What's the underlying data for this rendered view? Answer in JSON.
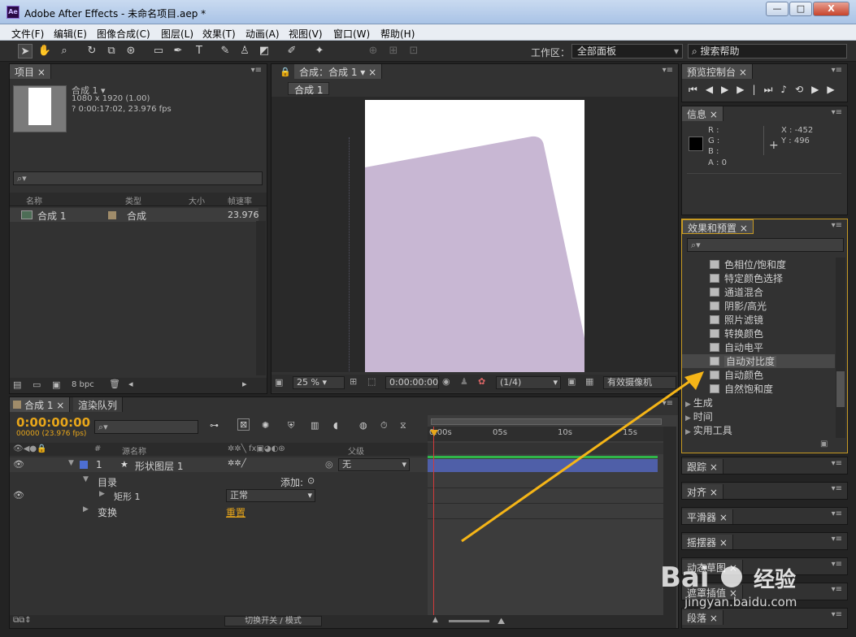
{
  "window": {
    "title": "Adobe After Effects - 未命名项目.aep *",
    "logo": "Ae",
    "minimize": "—",
    "maximize": "□",
    "close": "X"
  },
  "menus": [
    "文件(F)",
    "编辑(E)",
    "图像合成(C)",
    "图层(L)",
    "效果(T)",
    "动画(A)",
    "视图(V)",
    "窗口(W)",
    "帮助(H)"
  ],
  "toolbar": {
    "workspace_label": "工作区：",
    "workspace_value": "全部面板",
    "help_search": "搜索帮助"
  },
  "project": {
    "tab": "项目",
    "comp_name": "合成 1 ▾",
    "comp_size": "1080 x 1920 (1.00)",
    "comp_duration": "? 0:00:17:02, 23.976 fps",
    "search_placeholder": "⌕▾",
    "columns": [
      "名称",
      "类型",
      "大小",
      "帧速率"
    ],
    "item": {
      "name": "合成 1",
      "type": "合成",
      "fps": "23.976"
    },
    "bpc": "8 bpc"
  },
  "composition": {
    "tab": "合成：合成 1",
    "sub_tab": "合成 1",
    "zoom": "25 %",
    "timecode": "0:00:00:00",
    "resolution": "(1/4)",
    "camera": "有效摄像机"
  },
  "preview": {
    "tab": "预览控制台"
  },
  "info": {
    "tab": "信息",
    "r": "R :",
    "g": "G :",
    "b": "B :",
    "a": "A : 0",
    "x": "X : -452",
    "y": "Y : 496"
  },
  "effects": {
    "tab": "效果和预置",
    "search_placeholder": "⌕▾",
    "items": [
      "色相位/饱和度",
      "特定颜色选择",
      "通道混合",
      "阴影/高光",
      "照片滤镜",
      "转换颜色",
      "自动电平",
      "自动对比度",
      "自动颜色",
      "自然饱和度"
    ],
    "selected_index": 7,
    "categories": [
      "生成",
      "时间",
      "实用工具"
    ]
  },
  "side_panels": [
    "跟踪",
    "对齐",
    "平滑器",
    "摇摆器",
    "动态草图",
    "遮罩插值",
    "段落"
  ],
  "timeline": {
    "tabs": [
      "合成 1",
      "渲染队列"
    ],
    "timecode": "0:00:00:00",
    "timecode_sub": "00000 (23.976 fps)",
    "search_placeholder": "⌕▾",
    "columns": {
      "num": "#",
      "source": "源名称",
      "parent": "父级"
    },
    "ruler_marks": [
      "0:00s",
      "05s",
      "10s",
      "15s"
    ],
    "layer": {
      "num": "1",
      "name": "形状图层 1",
      "parent": "无"
    },
    "rows": [
      {
        "label": "目录",
        "extra": "添加:"
      },
      {
        "label": "矩形 1",
        "extra": "正常"
      },
      {
        "label": "变换",
        "extra": "重置"
      }
    ],
    "footer": "切换开关 / 模式"
  },
  "colors": {
    "shape_fill": "#c8b7d3",
    "layer_bar": "#4f5fa8",
    "timecode": "#e8a61a",
    "focus": "#c79a23",
    "arrow": "#f5b517"
  }
}
